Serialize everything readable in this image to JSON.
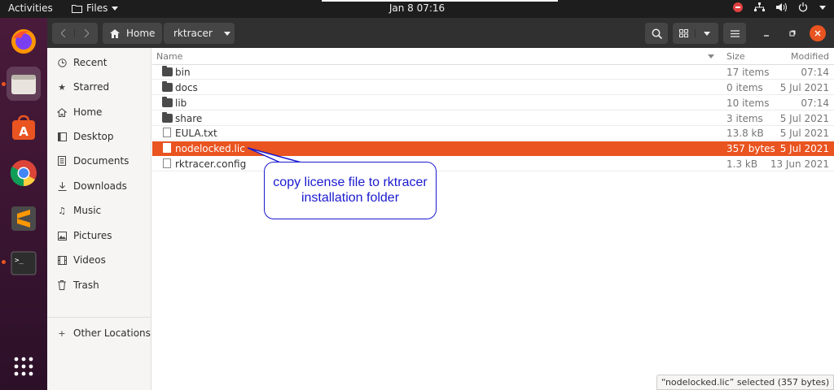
{
  "topbar": {
    "activities": "Activities",
    "app_name": "Files",
    "clock": "Jan 8  07:16"
  },
  "dock": {
    "items": [
      "firefox-icon",
      "files-icon",
      "ubuntu-software-icon",
      "chrome-icon",
      "sublime-text-icon",
      "terminal-icon",
      "show-apps-icon"
    ]
  },
  "header": {
    "path": [
      "Home",
      "rktracer"
    ]
  },
  "sidebar": {
    "items": [
      {
        "label": "Recent",
        "icon": "clock-icon"
      },
      {
        "label": "Starred",
        "icon": "star-icon"
      },
      {
        "label": "Home",
        "icon": "home-icon"
      },
      {
        "label": "Desktop",
        "icon": "desktop-icon"
      },
      {
        "label": "Documents",
        "icon": "document-icon"
      },
      {
        "label": "Downloads",
        "icon": "download-icon"
      },
      {
        "label": "Music",
        "icon": "music-icon"
      },
      {
        "label": "Pictures",
        "icon": "picture-icon"
      },
      {
        "label": "Videos",
        "icon": "video-icon"
      },
      {
        "label": "Trash",
        "icon": "trash-icon"
      }
    ],
    "other": {
      "label": "Other Locations",
      "icon": "plus-icon"
    }
  },
  "list": {
    "columns": {
      "name": "Name",
      "size": "Size",
      "modified": "Modified"
    },
    "rows": [
      {
        "name": "bin",
        "type": "folder",
        "size": "17 items",
        "modified": "07:14"
      },
      {
        "name": "docs",
        "type": "folder",
        "size": "0 items",
        "modified": "5 Jul 2021"
      },
      {
        "name": "lib",
        "type": "folder",
        "size": "10 items",
        "modified": "07:14"
      },
      {
        "name": "share",
        "type": "folder",
        "size": "3 items",
        "modified": "5 Jul 2021"
      },
      {
        "name": "EULA.txt",
        "type": "file",
        "size": "13.8 kB",
        "modified": "5 Jul 2021"
      },
      {
        "name": "nodelocked.lic",
        "type": "file",
        "size": "357 bytes",
        "modified": "5 Jul 2021",
        "selected": true
      },
      {
        "name": "rktracer.config",
        "type": "file",
        "size": "1.3 kB",
        "modified": "13 Jun 2021"
      }
    ]
  },
  "callout": {
    "line1": "copy license file to rktracer",
    "line2": "installation folder"
  },
  "status": "“nodelocked.lic” selected  (357 bytes)",
  "colors": {
    "selection": "#e95420",
    "callout": "#1a1ad0"
  }
}
